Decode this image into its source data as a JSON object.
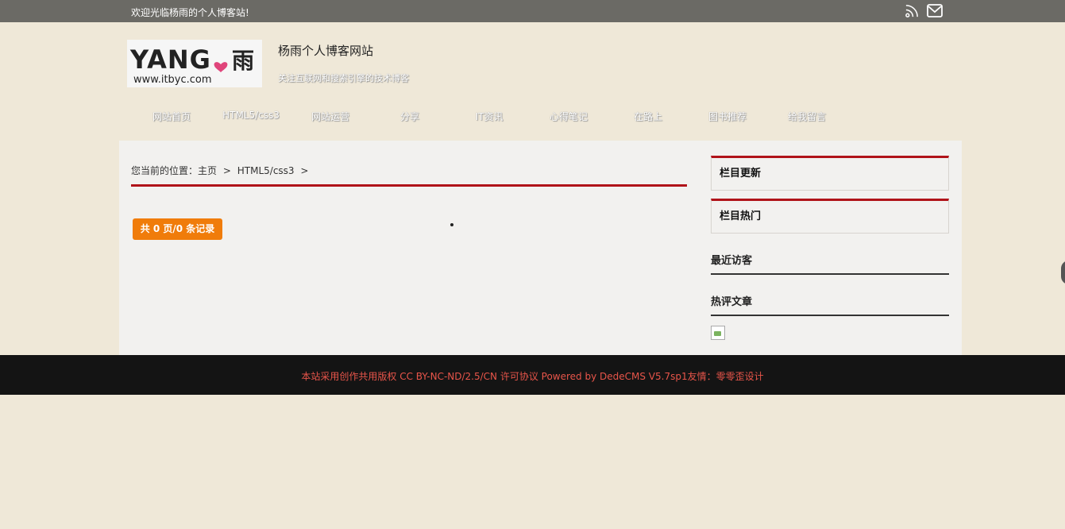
{
  "topbar": {
    "welcome": "欢迎光临杨雨的个人博客站!",
    "icons": [
      "rss-icon",
      "mail-icon"
    ]
  },
  "header": {
    "logo_text": "YANG",
    "logo_cn": "雨",
    "logo_url_text": "www.itbyc.com",
    "site_title": "杨雨个人博客网站",
    "site_subtitle": "关注互联网和搜索引擎的技术博客"
  },
  "nav": {
    "items": [
      {
        "label": "网站首页"
      },
      {
        "label": "HTML5/css3"
      },
      {
        "label": "网站运营"
      },
      {
        "label": "分享"
      },
      {
        "label": "IT资讯"
      },
      {
        "label": "心得笔记"
      },
      {
        "label": "在路上"
      },
      {
        "label": "图书推荐"
      },
      {
        "label": "给我留言"
      }
    ]
  },
  "main": {
    "breadcrumb": {
      "prefix": "您当前的位置：",
      "home": "主页",
      "sep1": ">",
      "category": "HTML5/css3",
      "sep2": ">"
    },
    "pager_text": "共 0 页/0 条记录"
  },
  "sidebar": {
    "box1_title": "栏目更新",
    "box2_title": "栏目热门",
    "recent_visitors": "最近访客",
    "hot_comments": "热评文章"
  },
  "footer": {
    "text": "本站采用创作共用版权 CC BY-NC-ND/2.5/CN 许可协议 Powered by DedeCMS V5.7sp1友情：零零歪设计"
  },
  "colors": {
    "background": "#efe8d8",
    "topbar": "#6b6a65",
    "accent_red": "#b01319",
    "pager_orange": "#f07c0a",
    "footer_bg": "#141414",
    "footer_text": "#e8554a"
  }
}
